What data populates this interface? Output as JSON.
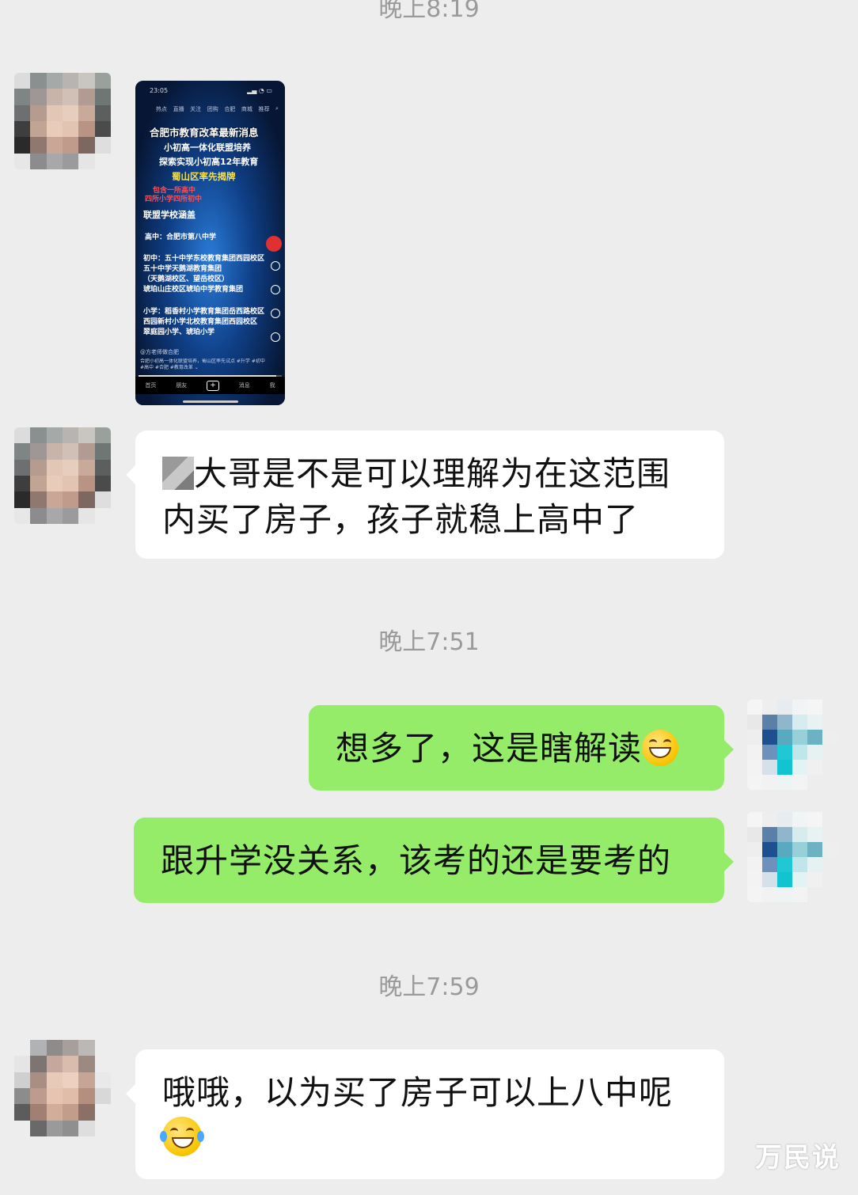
{
  "timestamps": {
    "top": "晚上8:19",
    "middle": "晚上7:51",
    "bottom": "晚上7:59"
  },
  "shared_screenshot": {
    "status_time": "23:05",
    "tabs": [
      "热点",
      "直播",
      "关注",
      "团购",
      "合肥",
      "商城",
      "推荐"
    ],
    "lines": [
      "合肥市教育改革最新消息",
      "小初高一体化联盟培养",
      "探索实现小初高12年教育",
      "蜀山区率先揭牌",
      "包含一所高中",
      "四所小学四所初中",
      "联盟学校涵盖",
      "高中：合肥市第八中学",
      "初中：五十中学东校教育集团西园校区",
      "五十中学天鹅湖教育集团",
      "（天鹅湖校区、望岳校区）",
      "琥珀山庄校区琥珀中学教育集团",
      "小学：稻香村小学教育集团岳西路校区",
      "西园新村小学北校教育集团西园校区",
      "翠庭园小学、琥珀小学"
    ],
    "author": "@方老师做合肥",
    "caption": "合肥小初高一体化联盟培养，蜀山区率先试点 #升学 #初中 #高中 #合肥 #教育改革 ⌄",
    "bottom_nav": [
      "首页",
      "朋友",
      "+",
      "消息",
      "我"
    ]
  },
  "messages": [
    {
      "side": "theirs",
      "redacted_prefix": true,
      "line1": "大哥是不是可以理解为在这范围",
      "line2": "内买了房子，孩子就稳上高中了"
    },
    {
      "side": "mine",
      "text": "想多了，这是瞎解读",
      "emoji": "grin-emoji"
    },
    {
      "side": "mine",
      "text": "跟升学没关系，该考的还是要考的"
    },
    {
      "side": "theirs",
      "text": "哦哦，以为买了房子可以上八中呢",
      "emoji": "cry-laugh-emoji"
    }
  ],
  "watermark": "万民说",
  "colors": {
    "background": "#ededed",
    "mine_bubble": "#95ec69",
    "theirs_bubble": "#ffffff",
    "timestamp": "#9a9a9a"
  }
}
